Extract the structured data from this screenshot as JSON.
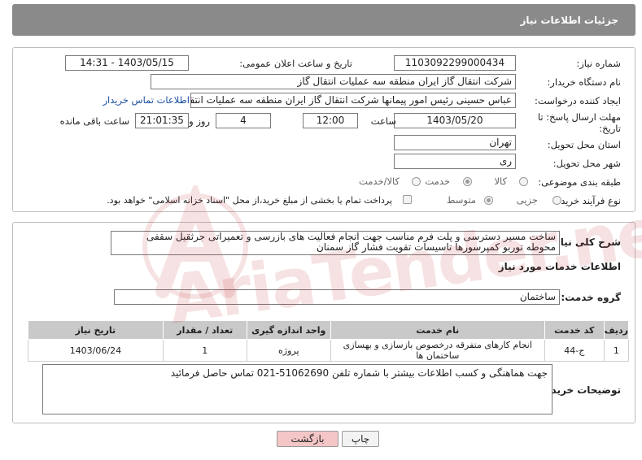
{
  "header": {
    "title": "جزئیات اطلاعات نیاز"
  },
  "form": {
    "need_number_label": "شماره نیاز:",
    "need_number": "1103092299000434",
    "announce_label": "تاریخ و ساعت اعلان عمومی:",
    "announce_value": "1403/05/15 - 14:31",
    "buyer_org_label": "نام دستگاه خریدار:",
    "buyer_org": "شرکت انتقال گاز ایران منطقه سه عملیات انتقال گاز",
    "creator_label": "ایجاد کننده درخواست:",
    "creator": "عباس حسینی رئیس امور پیمانها شرکت انتقال گاز ایران منطقه سه عملیات انتقال گاز",
    "contact_link": "اطلاعات تماس خریدار",
    "deadline_label_1": "مهلت ارسال پاسخ: تا",
    "deadline_label_2": "تاریخ:",
    "deadline_date": "1403/05/20",
    "time_label": "ساعت",
    "deadline_time": "12:00",
    "days_value": "4",
    "days_label": "روز و",
    "remaining_time": "21:01:35",
    "remaining_label": "ساعت باقی مانده",
    "province_label": "استان محل تحویل:",
    "province": "تهران",
    "city_label": "شهر محل تحویل:",
    "city": "ری",
    "category_label": "طبقه بندی موضوعی:",
    "category_options": [
      "کالا",
      "خدمت",
      "کالا/خدمت"
    ],
    "category_selected": "خدمت",
    "process_label": "نوع فرآیند خرید :",
    "process_options": [
      "جزیی",
      "متوسط"
    ],
    "process_selected": "متوسط",
    "payment_note": "پرداخت تمام یا بخشی از مبلغ خرید،از محل \"اسناد خزانه اسلامی\" خواهد بود."
  },
  "summary": {
    "label": "شرح کلی نیاز:",
    "text": "ساخت مسیر دسترسی و پلت فرم مناسب جهت انجام فعالیت های بازرسی و تعمیراتی جرثقیل سقفی محوطه توربو کمپرسورها تاسیسات تقویت فشار گاز سمنان"
  },
  "services": {
    "title": "اطلاعات خدمات مورد نیاز",
    "group_label": "گروه خدمت:",
    "group_value": "ساختمان",
    "columns": [
      "ردیف",
      "کد خدمت",
      "نام خدمت",
      "واحد اندازه گیری",
      "تعداد / مقدار",
      "تاریخ نیاز"
    ],
    "rows": [
      [
        "1",
        "ج-44",
        "انجام کارهای متفرقه درخصوص بازسازی و بهسازی ساختمان ها",
        "پروژه",
        "1",
        "1403/06/24"
      ]
    ]
  },
  "buyer_notes": {
    "label": "توضیحات خریدار:",
    "text": "جهت هماهنگی و کسب اطلاعات بیشتر با شماره تلفن 51062690-021 تماس حاصل فرمائید"
  },
  "buttons": {
    "print": "چاپ",
    "back": "بازگشت"
  },
  "watermark": "AriaTender.net",
  "colors": {
    "header_bg": "#8b8b8b",
    "link": "#1a4fa0",
    "back_btn": "#f4c6c6"
  }
}
